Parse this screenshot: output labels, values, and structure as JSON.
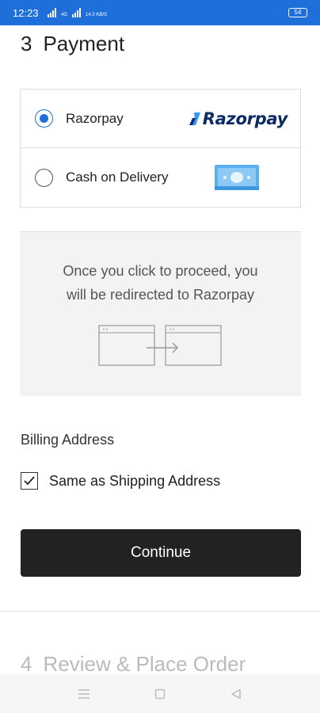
{
  "status_bar": {
    "time": "12:23",
    "net1": "4G",
    "net2": "14.0 KB/S",
    "battery": "54"
  },
  "payment": {
    "step_number": "3",
    "title": "Payment",
    "options": [
      {
        "label": "Razorpay",
        "selected": true,
        "logo_text": "Razorpay"
      },
      {
        "label": "Cash on Delivery",
        "selected": false
      }
    ],
    "redirect_info": [
      "Once you click to proceed, you",
      "will be redirected to Razorpay"
    ]
  },
  "billing": {
    "title": "Billing Address",
    "same_as_shipping_label": "Same as Shipping Address",
    "same_as_shipping_checked": true
  },
  "continue_label": "Continue",
  "next_step": {
    "step_number": "4",
    "title": "Review & Place Order"
  },
  "colors": {
    "accent": "#1e6fd9",
    "button": "#222222",
    "razorpay_navy": "#0b2a66",
    "razorpay_blue": "#3395ff"
  },
  "nav": [
    "menu-icon",
    "home-icon",
    "back-icon"
  ]
}
